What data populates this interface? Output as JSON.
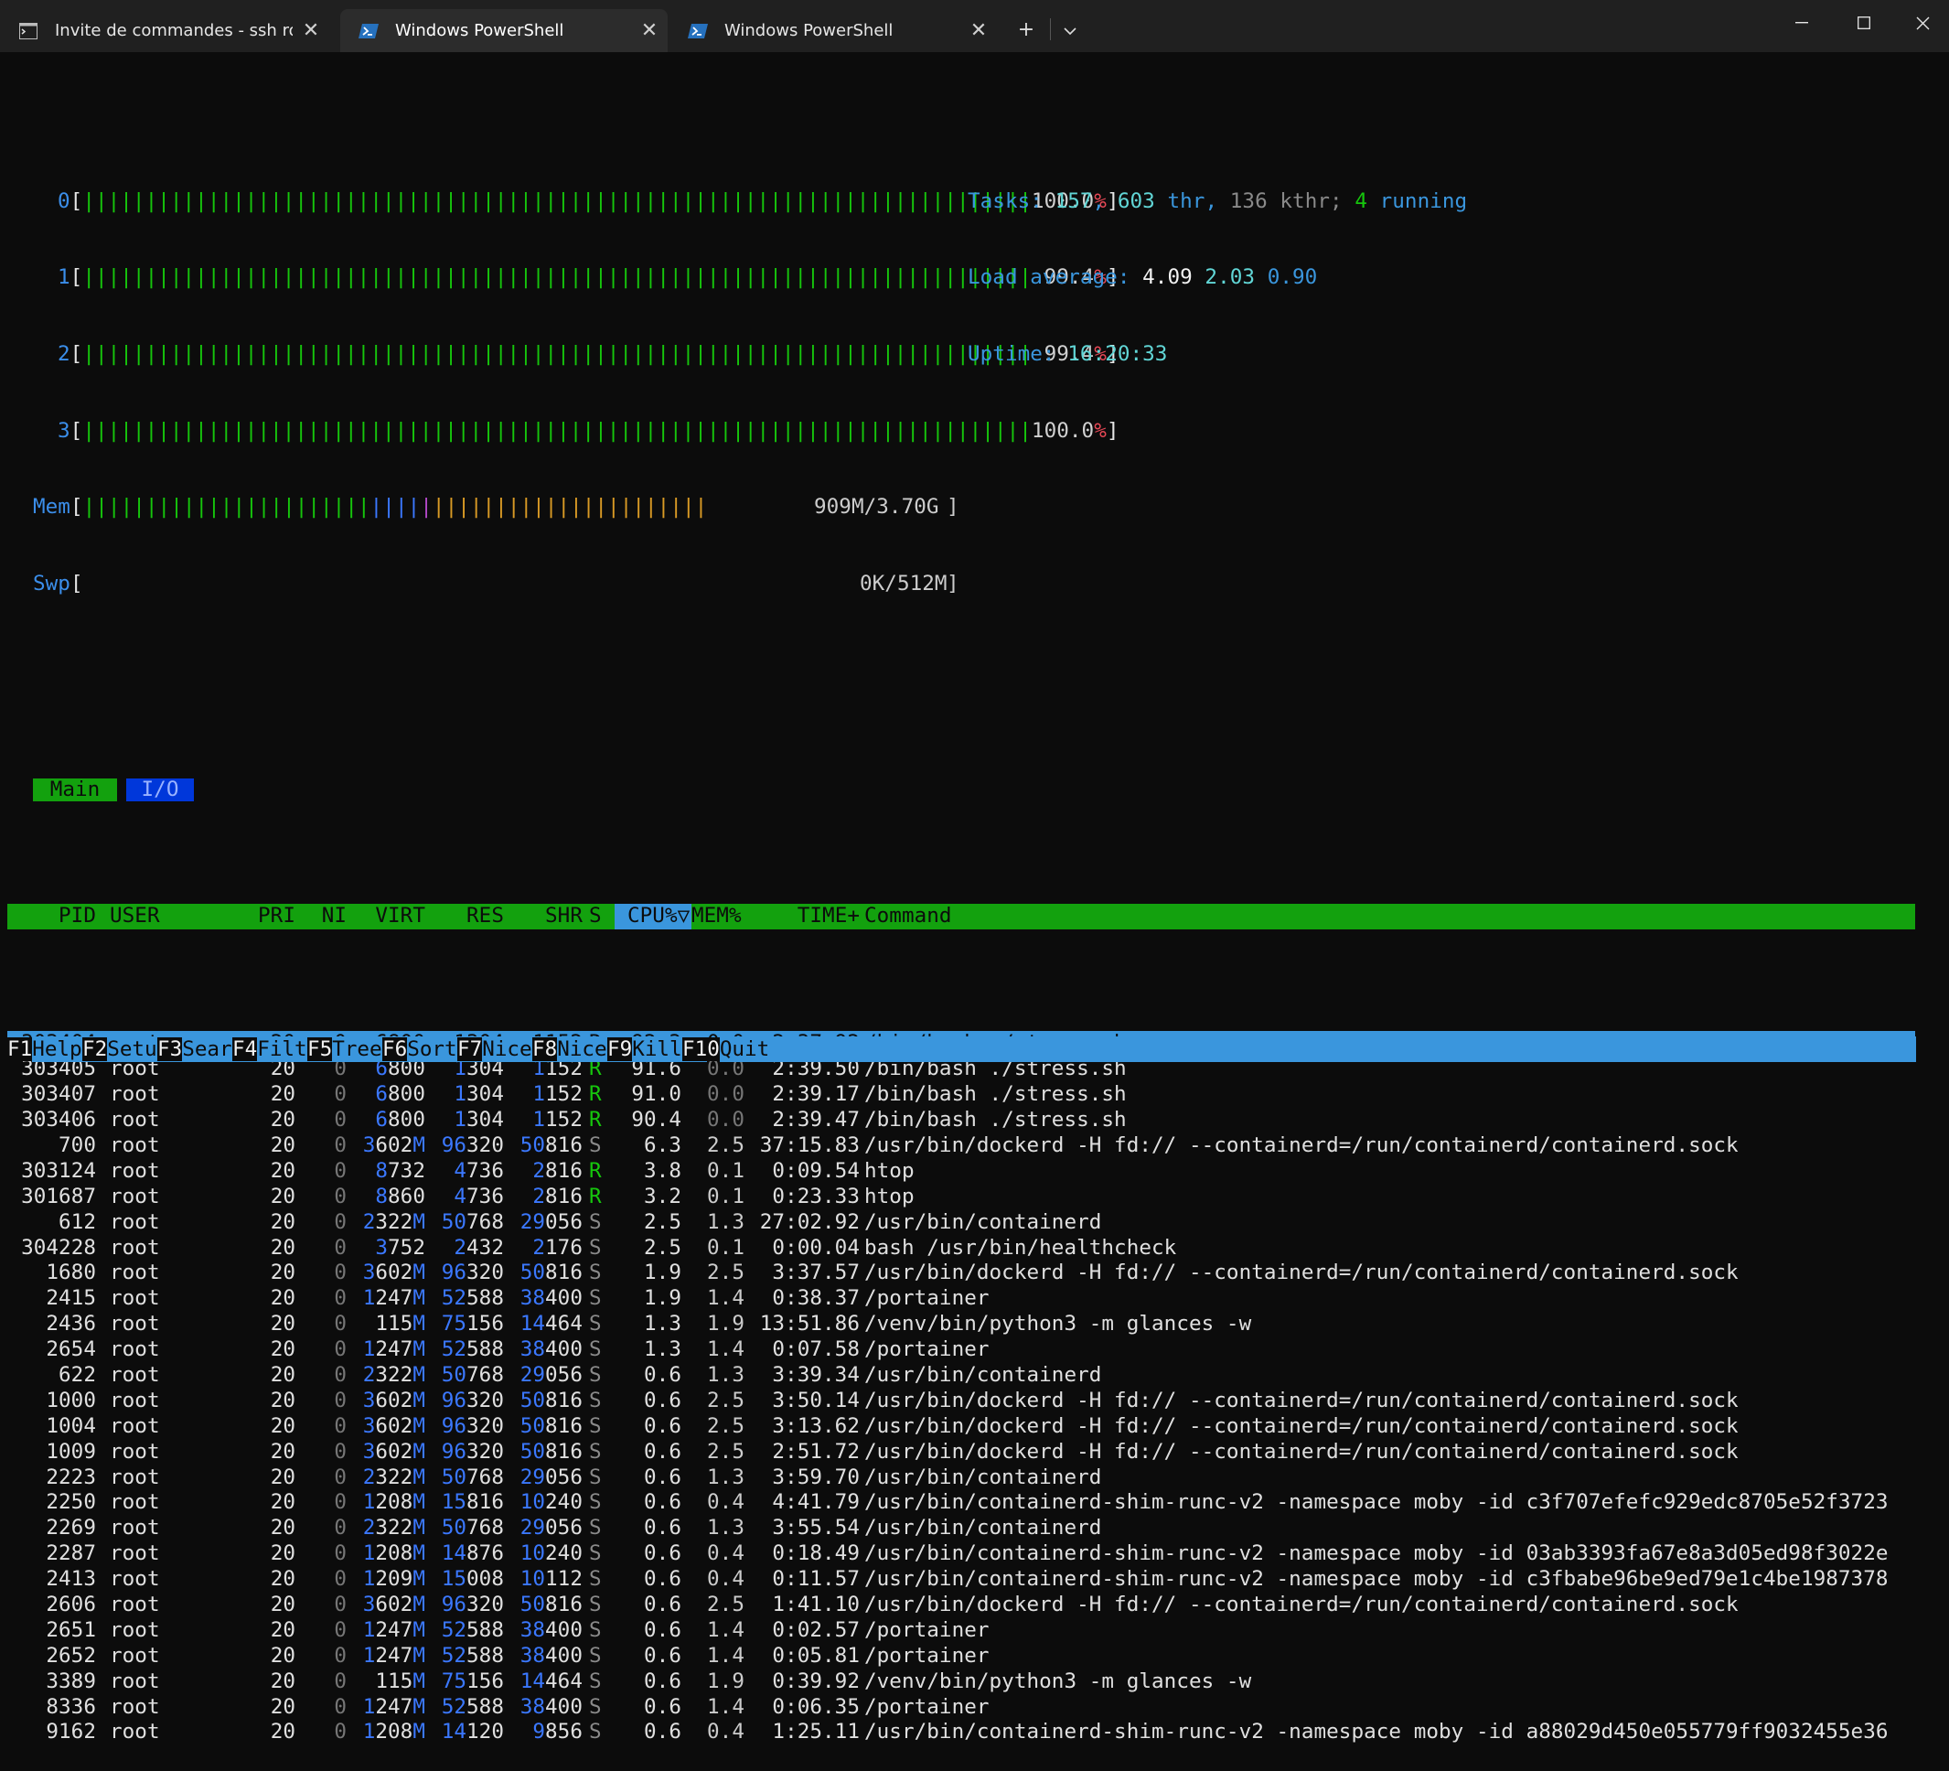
{
  "window": {
    "tabs": [
      {
        "label": "Invite de commandes - ssh  ro",
        "icon": "cmd-icon",
        "active": false
      },
      {
        "label": "Windows PowerShell",
        "icon": "powershell-icon",
        "active": true
      },
      {
        "label": "Windows PowerShell",
        "icon": "powershell-icon",
        "active": false
      }
    ],
    "close_glyph": "✕",
    "new_tab_glyph": "+",
    "dropdown_glyph": "⌄"
  },
  "cpu_meters": [
    {
      "label": "0",
      "bars": "||||||||||||||||||||||||||||||||||||||||||||||||||||||||||||||||||||||||||||",
      "pct_main": "100.0",
      "pct_end": "%"
    },
    {
      "label": "1",
      "bars": "||||||||||||||||||||||||||||||||||||||||||||||||||||||||||||||||||||||||||||",
      "pct_main": "99.4",
      "pct_end": "%"
    },
    {
      "label": "2",
      "bars": "||||||||||||||||||||||||||||||||||||||||||||||||||||||||||||||||||||||||||||",
      "pct_main": "99.4",
      "pct_end": "%"
    },
    {
      "label": "3",
      "bars": "||||||||||||||||||||||||||||||||||||||||||||||||||||||||||||||||||||||||||||",
      "pct_main": "100.0",
      "pct_end": "%"
    }
  ],
  "mem_meter": {
    "label": "Mem",
    "bars_green": "|||||||||||||||||||||||",
    "bars_blue": "||||",
    "bars_magenta": "|",
    "bars_yellow": "||||||||||||||||||||||",
    "value": "909M/3.70G"
  },
  "swp_meter": {
    "label": "Swp",
    "value": "0K/512M"
  },
  "stats": {
    "tasks_label": "Tasks:",
    "tasks": "157",
    "thr": "603",
    "thr_label": "thr,",
    "kthr": "136",
    "kthr_label": "kthr;",
    "running": "4",
    "running_label": "running",
    "load_label": "Load average:",
    "load1": "4.09",
    "load5": "2.03",
    "load15": "0.90",
    "uptime_label": "Uptime:",
    "uptime": "16:20:33"
  },
  "screen_tabs": {
    "main": "Main",
    "io": "I/O"
  },
  "header": {
    "pid": "PID",
    "user": "USER",
    "pri": "PRI",
    "ni": "NI",
    "virt": "VIRT",
    "res": "RES",
    "shr": "SHR",
    "s": "S",
    "cpu": "CPU%▽",
    "mem": "MEM%",
    "time": "TIME+",
    "command": "Command"
  },
  "processes": [
    {
      "pid": "303404",
      "user": "root",
      "pri": "20",
      "ni": "0",
      "virt": "6800",
      "res": "1304",
      "shr": "1152",
      "s": "R",
      "cpu": "92.3",
      "mem": "0.0",
      "time": "2:37.92",
      "cmd": "/bin/bash ./stress.sh",
      "selected": true,
      "thread": false
    },
    {
      "pid": "303405",
      "user": "root",
      "pri": "20",
      "ni": "0",
      "virt": "6800",
      "res": "1304",
      "shr": "1152",
      "s": "R",
      "cpu": "91.6",
      "mem": "0.0",
      "time": "2:39.50",
      "cmd": "/bin/bash ./stress.sh",
      "selected": false,
      "thread": false
    },
    {
      "pid": "303407",
      "user": "root",
      "pri": "20",
      "ni": "0",
      "virt": "6800",
      "res": "1304",
      "shr": "1152",
      "s": "R",
      "cpu": "91.0",
      "mem": "0.0",
      "time": "2:39.17",
      "cmd": "/bin/bash ./stress.sh",
      "selected": false,
      "thread": false
    },
    {
      "pid": "303406",
      "user": "root",
      "pri": "20",
      "ni": "0",
      "virt": "6800",
      "res": "1304",
      "shr": "1152",
      "s": "R",
      "cpu": "90.4",
      "mem": "0.0",
      "time": "2:39.47",
      "cmd": "/bin/bash ./stress.sh",
      "selected": false,
      "thread": false
    },
    {
      "pid": "700",
      "user": "root",
      "pri": "20",
      "ni": "0",
      "virt": "3602M",
      "res": "96320",
      "shr": "50816",
      "s": "S",
      "cpu": "6.3",
      "mem": "2.5",
      "time": "37:15.83",
      "cmd": "/usr/bin/dockerd -H fd:// --containerd=/run/containerd/containerd.sock",
      "selected": false,
      "thread": false
    },
    {
      "pid": "303124",
      "user": "root",
      "pri": "20",
      "ni": "0",
      "virt": "8732",
      "res": "4736",
      "shr": "2816",
      "s": "R",
      "cpu": "3.8",
      "mem": "0.1",
      "time": "0:09.54",
      "cmd": "htop",
      "selected": false,
      "thread": false
    },
    {
      "pid": "301687",
      "user": "root",
      "pri": "20",
      "ni": "0",
      "virt": "8860",
      "res": "4736",
      "shr": "2816",
      "s": "R",
      "cpu": "3.2",
      "mem": "0.1",
      "time": "0:23.33",
      "cmd": "htop",
      "selected": false,
      "thread": false
    },
    {
      "pid": "612",
      "user": "root",
      "pri": "20",
      "ni": "0",
      "virt": "2322M",
      "res": "50768",
      "shr": "29056",
      "s": "S",
      "cpu": "2.5",
      "mem": "1.3",
      "time": "27:02.92",
      "cmd": "/usr/bin/containerd",
      "selected": false,
      "thread": false
    },
    {
      "pid": "304228",
      "user": "root",
      "pri": "20",
      "ni": "0",
      "virt": "3752",
      "res": "2432",
      "shr": "2176",
      "s": "S",
      "cpu": "2.5",
      "mem": "0.1",
      "time": "0:00.04",
      "cmd": "bash /usr/bin/healthcheck",
      "selected": false,
      "thread": false
    },
    {
      "pid": "1680",
      "user": "root",
      "pri": "20",
      "ni": "0",
      "virt": "3602M",
      "res": "96320",
      "shr": "50816",
      "s": "S",
      "cpu": "1.9",
      "mem": "2.5",
      "time": "3:37.57",
      "cmd": "/usr/bin/dockerd -H fd:// --containerd=/run/containerd/containerd.sock",
      "selected": false,
      "thread": true
    },
    {
      "pid": "2415",
      "user": "root",
      "pri": "20",
      "ni": "0",
      "virt": "1247M",
      "res": "52588",
      "shr": "38400",
      "s": "S",
      "cpu": "1.9",
      "mem": "1.4",
      "time": "0:38.37",
      "cmd": "/portainer",
      "selected": false,
      "thread": false
    },
    {
      "pid": "2436",
      "user": "root",
      "pri": "20",
      "ni": "0",
      "virt": "115M",
      "res": "75156",
      "shr": "14464",
      "s": "S",
      "cpu": "1.3",
      "mem": "1.9",
      "time": "13:51.86",
      "cmd": "/venv/bin/python3 -m glances -w",
      "selected": false,
      "thread": false
    },
    {
      "pid": "2654",
      "user": "root",
      "pri": "20",
      "ni": "0",
      "virt": "1247M",
      "res": "52588",
      "shr": "38400",
      "s": "S",
      "cpu": "1.3",
      "mem": "1.4",
      "time": "0:07.58",
      "cmd": "/portainer",
      "selected": false,
      "thread": true
    },
    {
      "pid": "622",
      "user": "root",
      "pri": "20",
      "ni": "0",
      "virt": "2322M",
      "res": "50768",
      "shr": "29056",
      "s": "S",
      "cpu": "0.6",
      "mem": "1.3",
      "time": "3:39.34",
      "cmd": "/usr/bin/containerd",
      "selected": false,
      "thread": true
    },
    {
      "pid": "1000",
      "user": "root",
      "pri": "20",
      "ni": "0",
      "virt": "3602M",
      "res": "96320",
      "shr": "50816",
      "s": "S",
      "cpu": "0.6",
      "mem": "2.5",
      "time": "3:50.14",
      "cmd": "/usr/bin/dockerd -H fd:// --containerd=/run/containerd/containerd.sock",
      "selected": false,
      "thread": true
    },
    {
      "pid": "1004",
      "user": "root",
      "pri": "20",
      "ni": "0",
      "virt": "3602M",
      "res": "96320",
      "shr": "50816",
      "s": "S",
      "cpu": "0.6",
      "mem": "2.5",
      "time": "3:13.62",
      "cmd": "/usr/bin/dockerd -H fd:// --containerd=/run/containerd/containerd.sock",
      "selected": false,
      "thread": true
    },
    {
      "pid": "1009",
      "user": "root",
      "pri": "20",
      "ni": "0",
      "virt": "3602M",
      "res": "96320",
      "shr": "50816",
      "s": "S",
      "cpu": "0.6",
      "mem": "2.5",
      "time": "2:51.72",
      "cmd": "/usr/bin/dockerd -H fd:// --containerd=/run/containerd/containerd.sock",
      "selected": false,
      "thread": true
    },
    {
      "pid": "2223",
      "user": "root",
      "pri": "20",
      "ni": "0",
      "virt": "2322M",
      "res": "50768",
      "shr": "29056",
      "s": "S",
      "cpu": "0.6",
      "mem": "1.3",
      "time": "3:59.70",
      "cmd": "/usr/bin/containerd",
      "selected": false,
      "thread": true
    },
    {
      "pid": "2250",
      "user": "root",
      "pri": "20",
      "ni": "0",
      "virt": "1208M",
      "res": "15816",
      "shr": "10240",
      "s": "S",
      "cpu": "0.6",
      "mem": "0.4",
      "time": "4:41.79",
      "cmd": "/usr/bin/containerd-shim-runc-v2 -namespace moby -id c3f707efefc929edc8705e52f3723",
      "selected": false,
      "thread": false
    },
    {
      "pid": "2269",
      "user": "root",
      "pri": "20",
      "ni": "0",
      "virt": "2322M",
      "res": "50768",
      "shr": "29056",
      "s": "S",
      "cpu": "0.6",
      "mem": "1.3",
      "time": "3:55.54",
      "cmd": "/usr/bin/containerd",
      "selected": false,
      "thread": true
    },
    {
      "pid": "2287",
      "user": "root",
      "pri": "20",
      "ni": "0",
      "virt": "1208M",
      "res": "14876",
      "shr": "10240",
      "s": "S",
      "cpu": "0.6",
      "mem": "0.4",
      "time": "0:18.49",
      "cmd": "/usr/bin/containerd-shim-runc-v2 -namespace moby -id 03ab3393fa67e8a3d05ed98f3022e",
      "selected": false,
      "thread": true
    },
    {
      "pid": "2413",
      "user": "root",
      "pri": "20",
      "ni": "0",
      "virt": "1209M",
      "res": "15008",
      "shr": "10112",
      "s": "S",
      "cpu": "0.6",
      "mem": "0.4",
      "time": "0:11.57",
      "cmd": "/usr/bin/containerd-shim-runc-v2 -namespace moby -id c3fbabe96be9ed79e1c4be1987378",
      "selected": false,
      "thread": true
    },
    {
      "pid": "2606",
      "user": "root",
      "pri": "20",
      "ni": "0",
      "virt": "3602M",
      "res": "96320",
      "shr": "50816",
      "s": "S",
      "cpu": "0.6",
      "mem": "2.5",
      "time": "1:41.10",
      "cmd": "/usr/bin/dockerd -H fd:// --containerd=/run/containerd/containerd.sock",
      "selected": false,
      "thread": true
    },
    {
      "pid": "2651",
      "user": "root",
      "pri": "20",
      "ni": "0",
      "virt": "1247M",
      "res": "52588",
      "shr": "38400",
      "s": "S",
      "cpu": "0.6",
      "mem": "1.4",
      "time": "0:02.57",
      "cmd": "/portainer",
      "selected": false,
      "thread": true
    },
    {
      "pid": "2652",
      "user": "root",
      "pri": "20",
      "ni": "0",
      "virt": "1247M",
      "res": "52588",
      "shr": "38400",
      "s": "S",
      "cpu": "0.6",
      "mem": "1.4",
      "time": "0:05.81",
      "cmd": "/portainer",
      "selected": false,
      "thread": true
    },
    {
      "pid": "3389",
      "user": "root",
      "pri": "20",
      "ni": "0",
      "virt": "115M",
      "res": "75156",
      "shr": "14464",
      "s": "S",
      "cpu": "0.6",
      "mem": "1.9",
      "time": "0:39.92",
      "cmd": "/venv/bin/python3 -m glances -w",
      "selected": false,
      "thread": true
    },
    {
      "pid": "8336",
      "user": "root",
      "pri": "20",
      "ni": "0",
      "virt": "1247M",
      "res": "52588",
      "shr": "38400",
      "s": "S",
      "cpu": "0.6",
      "mem": "1.4",
      "time": "0:06.35",
      "cmd": "/portainer",
      "selected": false,
      "thread": true
    },
    {
      "pid": "9162",
      "user": "root",
      "pri": "20",
      "ni": "0",
      "virt": "1208M",
      "res": "14120",
      "shr": "9856",
      "s": "S",
      "cpu": "0.6",
      "mem": "0.4",
      "time": "1:25.11",
      "cmd": "/usr/bin/containerd-shim-runc-v2 -namespace moby -id a88029d450e055779ff9032455e36",
      "selected": false,
      "thread": false
    }
  ],
  "function_keys": [
    {
      "key": "F1",
      "label": "Help  "
    },
    {
      "key": "F2",
      "label": "Setup "
    },
    {
      "key": "F3",
      "label": "Search"
    },
    {
      "key": "F4",
      "label": "Filter"
    },
    {
      "key": "F5",
      "label": "Tree  "
    },
    {
      "key": "F6",
      "label": "SortBy"
    },
    {
      "key": "F7",
      "label": "Nice -"
    },
    {
      "key": "F8",
      "label": "Nice +"
    },
    {
      "key": "F9",
      "label": "Kill  "
    },
    {
      "key": "F10",
      "label": "Quit"
    }
  ],
  "colors": {
    "terminal_bg": "#0c0c0c",
    "header_green": "#13a10e",
    "selection_blue": "#3a96dd",
    "thread_green": "#16c60c"
  }
}
